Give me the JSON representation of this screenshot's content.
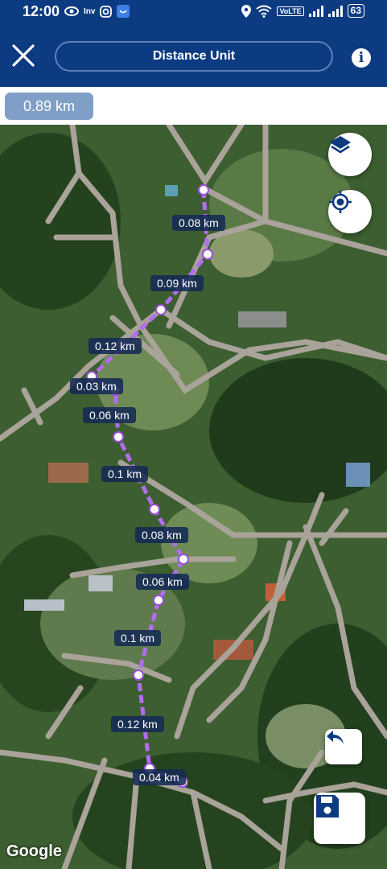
{
  "status_bar": {
    "time": "12:00",
    "left_icons": [
      "eye-icon",
      "inv-icon",
      "instagram-icon",
      "app-icon"
    ],
    "inv_text": "Inv",
    "volte_text": "VoLTE",
    "battery": "63"
  },
  "header": {
    "title": "Distance Unit",
    "info_label": "i"
  },
  "total_distance": "0.89 km",
  "segments": [
    {
      "label": "0.08 km"
    },
    {
      "label": "0.09 km"
    },
    {
      "label": "0.12 km"
    },
    {
      "label": "0.03 km"
    },
    {
      "label": "0.06 km"
    },
    {
      "label": "0.1 km"
    },
    {
      "label": "0.08 km"
    },
    {
      "label": "0.06 km"
    },
    {
      "label": "0.1 km"
    },
    {
      "label": "0.12 km"
    },
    {
      "label": "0.04 km"
    }
  ],
  "map": {
    "attribution": "Google",
    "path_color": "#b46cf0",
    "road_color": "#a9a39a"
  },
  "buttons": {
    "layers_icon": "layers-icon",
    "locate_icon": "my-location-icon",
    "undo_icon": "undo-icon",
    "save_icon": "save-icon"
  }
}
